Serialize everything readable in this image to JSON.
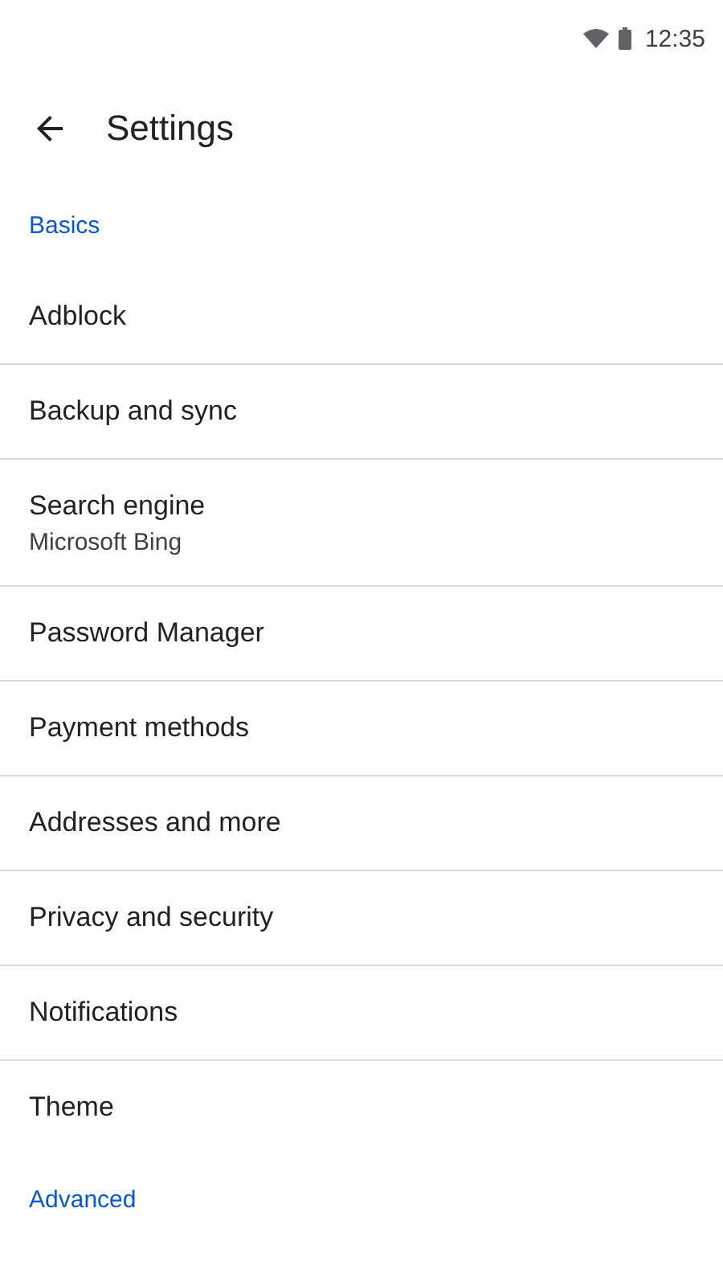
{
  "status_bar": {
    "time": "12:35"
  },
  "toolbar": {
    "title": "Settings"
  },
  "sections": [
    {
      "header": "Basics",
      "items": [
        {
          "label": "Adblock"
        },
        {
          "label": "Backup and sync"
        },
        {
          "label": "Search engine",
          "summary": "Microsoft Bing"
        },
        {
          "label": "Password Manager"
        },
        {
          "label": "Payment methods"
        },
        {
          "label": "Addresses and more"
        },
        {
          "label": "Privacy and security"
        },
        {
          "label": "Notifications"
        },
        {
          "label": "Theme"
        }
      ]
    },
    {
      "header": "Advanced"
    }
  ]
}
